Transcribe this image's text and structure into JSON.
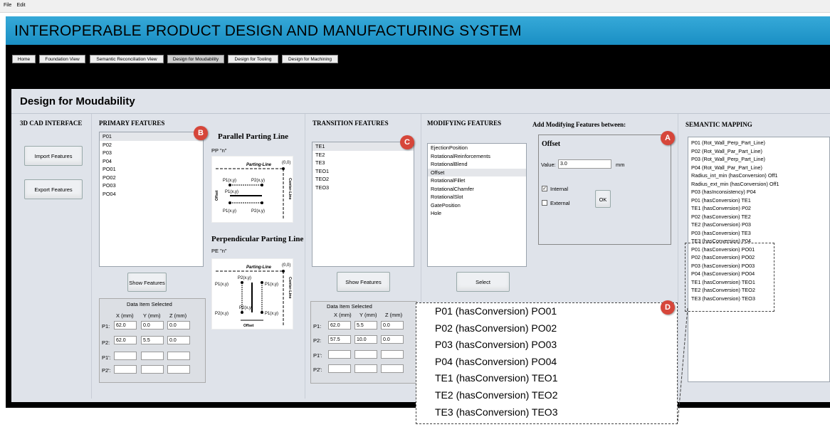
{
  "menu": {
    "items": [
      "File",
      "Edit"
    ]
  },
  "app_title": "INTEROPERABLE PRODUCT DESIGN AND MANUFACTURING SYSTEM",
  "nav": {
    "tabs": [
      "Home",
      "Foundation View",
      "Semantic Reconciliation View",
      "Design for Moudability",
      "Design for Tooling",
      "Design for Machining"
    ]
  },
  "page_title": "Design for Moudability",
  "cad": {
    "header": "3D CAD INTERFACE",
    "import_label": "Import Features",
    "export_label": "Export Features"
  },
  "primary": {
    "header": "PRIMARY FEATURES",
    "items": [
      "P01",
      "P02",
      "P03",
      "P04",
      "PO01",
      "PO02",
      "PO03",
      "PO04"
    ],
    "selected_index": 0,
    "show_label": "Show Features",
    "data_title": "Data Item Selected",
    "cols": [
      "X (mm)",
      "Y (mm)",
      "Z (mm)"
    ],
    "rows": [
      {
        "label": "P1:",
        "values": [
          "62.0",
          "0.0",
          "0.0"
        ]
      },
      {
        "label": "P2:",
        "values": [
          "62.0",
          "5.5",
          "0.0"
        ]
      },
      {
        "label": "P1':",
        "values": [
          "",
          "",
          ""
        ]
      },
      {
        "label": "P2':",
        "values": [
          "",
          "",
          ""
        ]
      }
    ]
  },
  "diagrams": {
    "parallel": {
      "title": "Parallel Parting Line",
      "code": "PP \"n\"",
      "parting": "Parting-Line",
      "origin": "(0,0)",
      "center": "Center-Line",
      "offset": "Offset",
      "p1": "P1(x,y)",
      "p2": "P2(x,y)"
    },
    "perpendicular": {
      "title": "Perpendicular Parting Line",
      "code": "PE \"n\"",
      "parting": "Parting-Line",
      "origin": "(0,0)",
      "center": "Center-Line",
      "offset": "Offset",
      "p1": "P1(x,y)",
      "p2": "P2(x,y)"
    }
  },
  "transition": {
    "header": "TRANSITION FEATURES",
    "items": [
      "TE1",
      "TE2",
      "TE3",
      "TEO1",
      "TEO2",
      "TEO3"
    ],
    "selected_index": 0,
    "show_label": "Show Features",
    "data_title": "Data Item Selected",
    "cols": [
      "X (mm)",
      "Y (mm)",
      "Z (mm)"
    ],
    "rows": [
      {
        "label": "P1:",
        "values": [
          "62.0",
          "5.5",
          "0.0"
        ]
      },
      {
        "label": "P2:",
        "values": [
          "57.5",
          "10.0",
          "0.0"
        ]
      },
      {
        "label": "P1':",
        "values": [
          "",
          "",
          ""
        ]
      },
      {
        "label": "P2':",
        "values": [
          "",
          "",
          ""
        ]
      }
    ]
  },
  "modifying": {
    "header": "MODIFYING FEATURES",
    "items": [
      "EjectionPosition",
      "RotationalReinforcements",
      "RotationalBlend",
      "Offset",
      "RotationalFillet",
      "RotationalChamfer",
      "RotationalSlot",
      "GatePosition",
      "Hole"
    ],
    "selected_index": 3,
    "select_label": "Select"
  },
  "add_mod": {
    "header": "Add Modifying Features between:",
    "box_title": "Offset",
    "value_label": "Value:",
    "value": "3.0",
    "unit": "mm",
    "internal_label": "Internal",
    "internal_checked": true,
    "external_label": "External",
    "external_checked": false,
    "ok_label": "OK"
  },
  "semantic": {
    "header": "SEMANTIC MAPPING",
    "items": [
      "P01 (Rot_Wall_Perp_Part_Line)",
      "P02 (Rot_Wall_Par_Part_Line)",
      "P03 (Rot_Wall_Perp_Part_Line)",
      "P04 (Rot_Wall_Par_Part_Line)",
      "Radius_int_min (hasConversion) Off1",
      "Radius_ext_min (hasConversion) Off1",
      "P03 (hasInconsistency) P04",
      "P01 (hasConversion) TE1",
      "TE1 (hasConversion) P02",
      "P02 (hasConversion) TE2",
      "TE2 (hasConversion) P03",
      "P03 (hasConversion) TE3",
      "TE3 (hasConversion) P04",
      "P01 (hasConversion) PO01",
      "P02 (hasConversion) PO02",
      "P03 (hasConversion) PO03",
      "P04 (hasConversion) PO04",
      "TE1 (hasConversion) TEO1",
      "TE2 (hasConversion) TEO2",
      "TE3 (hasConversion) TEO3"
    ]
  },
  "zoom": {
    "items": [
      "P01 (hasConversion) PO01",
      "P02 (hasConversion) PO02",
      "P03 (hasConversion) PO03",
      "P04 (hasConversion) PO04",
      "TE1 (hasConversion) TEO1",
      "TE2 (hasConversion) TEO2",
      "TE3 (hasConversion) TEO3"
    ]
  },
  "callouts": {
    "a": "A",
    "b": "B",
    "c": "C",
    "d": "D"
  },
  "colors": {
    "title_bar": "#1a8fc4",
    "nav_bg": "#000000",
    "panel_bg": "#dfe3ea",
    "callout": "#d6463a"
  }
}
